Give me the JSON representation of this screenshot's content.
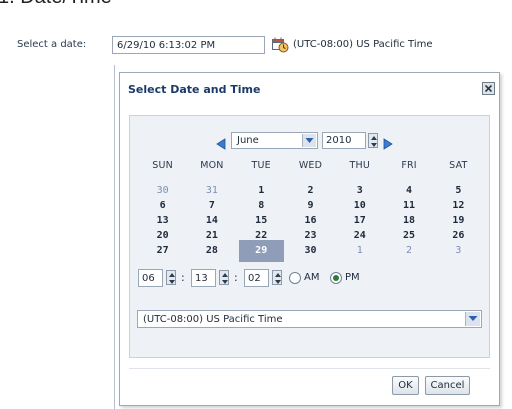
{
  "page": {
    "heading": "1. Date/Time"
  },
  "field": {
    "label": "Select a date:",
    "value": "6/29/10 6:13:02 PM",
    "timezone": "(UTC-08:00) US Pacific Time",
    "trigger_icon": "calendar-clock-icon"
  },
  "popup": {
    "title": "Select Date and Time",
    "close_icon": "close-icon",
    "month": "June",
    "year": "2010",
    "weekdays": [
      "SUN",
      "MON",
      "TUE",
      "WED",
      "THU",
      "FRI",
      "SAT"
    ],
    "days": [
      {
        "d": "30",
        "other": true
      },
      {
        "d": "31",
        "other": true
      },
      {
        "d": "1"
      },
      {
        "d": "2"
      },
      {
        "d": "3"
      },
      {
        "d": "4"
      },
      {
        "d": "5"
      },
      {
        "d": "6"
      },
      {
        "d": "7"
      },
      {
        "d": "8"
      },
      {
        "d": "9"
      },
      {
        "d": "10"
      },
      {
        "d": "11"
      },
      {
        "d": "12"
      },
      {
        "d": "13"
      },
      {
        "d": "14"
      },
      {
        "d": "15"
      },
      {
        "d": "16"
      },
      {
        "d": "17"
      },
      {
        "d": "18"
      },
      {
        "d": "19"
      },
      {
        "d": "20"
      },
      {
        "d": "21"
      },
      {
        "d": "22"
      },
      {
        "d": "23"
      },
      {
        "d": "24"
      },
      {
        "d": "25"
      },
      {
        "d": "26"
      },
      {
        "d": "27"
      },
      {
        "d": "28"
      },
      {
        "d": "29",
        "selected": true
      },
      {
        "d": "30"
      },
      {
        "d": "1",
        "other": true
      },
      {
        "d": "2",
        "other": true
      },
      {
        "d": "3",
        "other": true
      }
    ],
    "time": {
      "hour": "06",
      "minute": "13",
      "second": "02",
      "am_label": "AM",
      "pm_label": "PM",
      "selected_period": "PM"
    },
    "timezone": "(UTC-08:00) US Pacific Time",
    "ok_label": "OK",
    "cancel_label": "Cancel"
  },
  "colors": {
    "title": "#1c3a67",
    "panel_bg": "#eef2f6",
    "selected_day": "#8f9db9",
    "other_month_day": "#7e8db5",
    "radio_dot": "#2e7a3a"
  }
}
